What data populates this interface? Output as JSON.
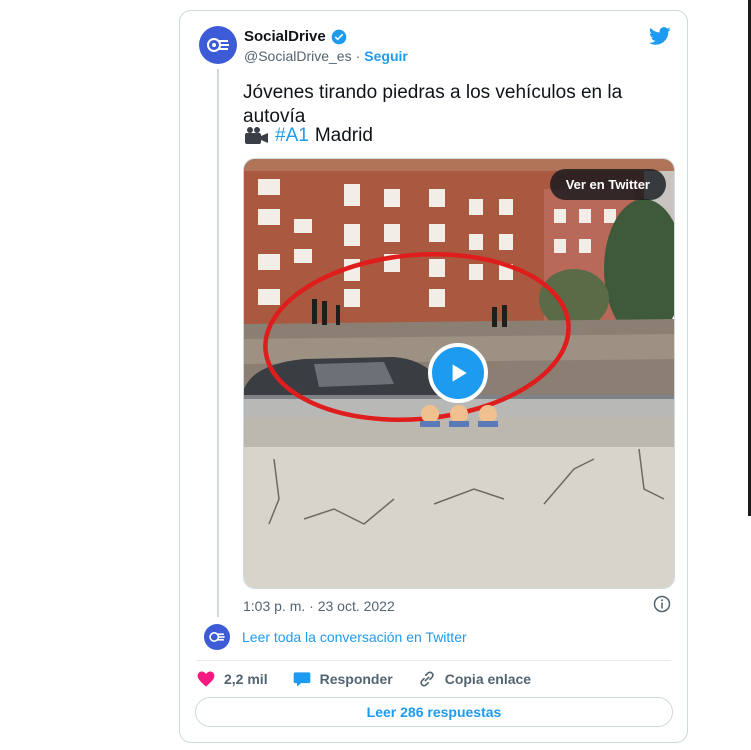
{
  "tweet": {
    "author_name": "SocialDrive",
    "author_handle": "@SocialDrive_es",
    "separator": "·",
    "follow_label": "Seguir",
    "text": "Jóvenes tirando piedras a los vehículos en la autovía",
    "line2_hashtag": "#A1",
    "line2_text": "Madrid",
    "media": {
      "overlay_button": "Ver en Twitter"
    },
    "timestamp": "1:03 p. m. · 23 oct. 2022",
    "conversation_link": "Leer toda la conversación en Twitter",
    "actions": {
      "likes": "2,2 mil",
      "reply_label": "Responder",
      "copy_link_label": "Copia enlace"
    },
    "replies_button": "Leer 286 respuestas"
  },
  "colors": {
    "accent": "#1d9bf0",
    "like": "#f91880",
    "avatar_bg": "#3d5bd6"
  },
  "icons": {
    "brand": "twitter-bird-icon",
    "verified": "verified-badge-icon",
    "camera": "video-camera-icon",
    "play": "play-icon",
    "info": "info-icon",
    "like": "heart-icon",
    "reply": "speech-bubble-icon",
    "copy": "link-icon"
  }
}
